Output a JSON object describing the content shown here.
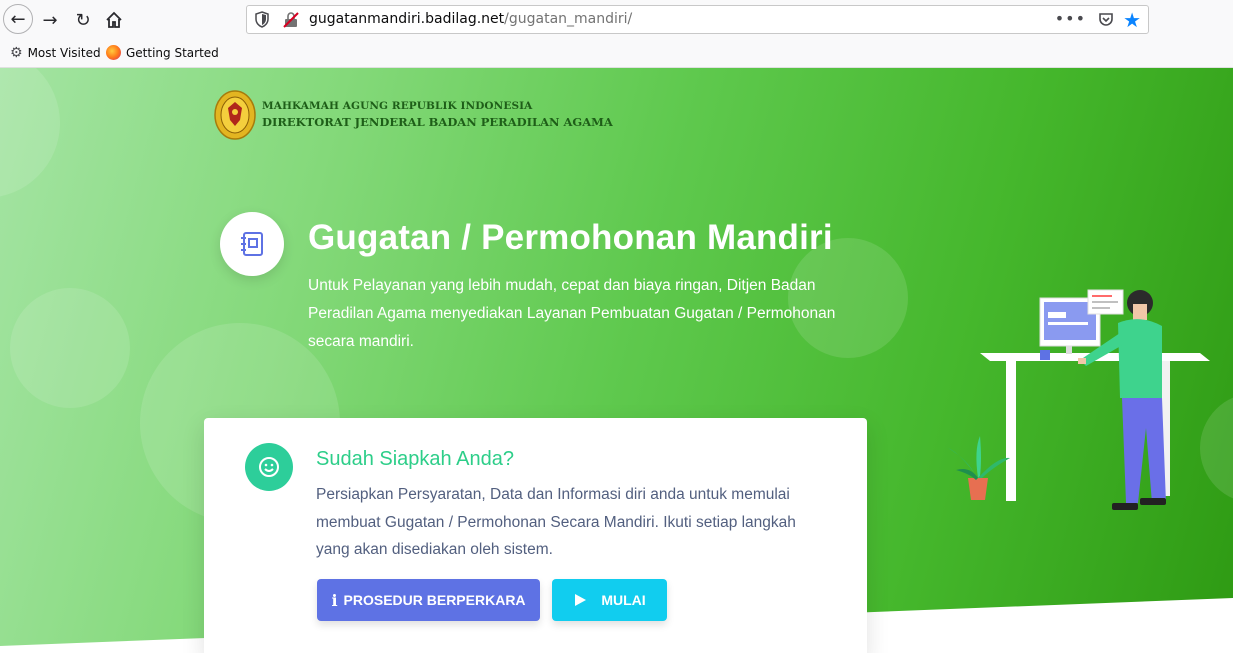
{
  "browser": {
    "url_domain": "gugatanmandiri.badilag.net",
    "url_path": "/gugatan_mandiri/",
    "url_prefix": "",
    "menu_dots": "•••",
    "bookmarks": [
      {
        "label": "Most Visited",
        "icon": "gear-icon"
      },
      {
        "label": "Getting Started",
        "icon": "firefox-icon"
      }
    ]
  },
  "header": {
    "org_line1": "MAHKAMAH AGUNG REPUBLIK INDONESIA",
    "org_line2": "DIREKTORAT JENDERAL BADAN PERADILAN AGAMA"
  },
  "hero": {
    "title": "Gugatan / Permohonan Mandiri",
    "description": "Untuk Pelayanan yang lebih mudah, cepat dan biaya ringan, Ditjen Badan Peradilan Agama menyediakan Layanan Pembuatan Gugatan / Permohonan secara mandiri.",
    "icon": "notebook-icon"
  },
  "card": {
    "icon": "smile-icon",
    "title": "Sudah Siapkah Anda?",
    "text": "Persiapkan Persyaratan, Data dan Informasi diri anda untuk memulai membuat Gugatan / Permohonan Secara Mandiri. Ikuti setiap langkah yang akan disediakan oleh sistem.",
    "btn_prosedur": "PROSEDUR BERPERKARA",
    "btn_prosedur_icon": "info-icon",
    "btn_mulai": "MULAI",
    "btn_mulai_icon": "play-icon"
  },
  "colors": {
    "accent_green": "#2dce89",
    "primary": "#5e72e4",
    "info": "#11cdef"
  }
}
